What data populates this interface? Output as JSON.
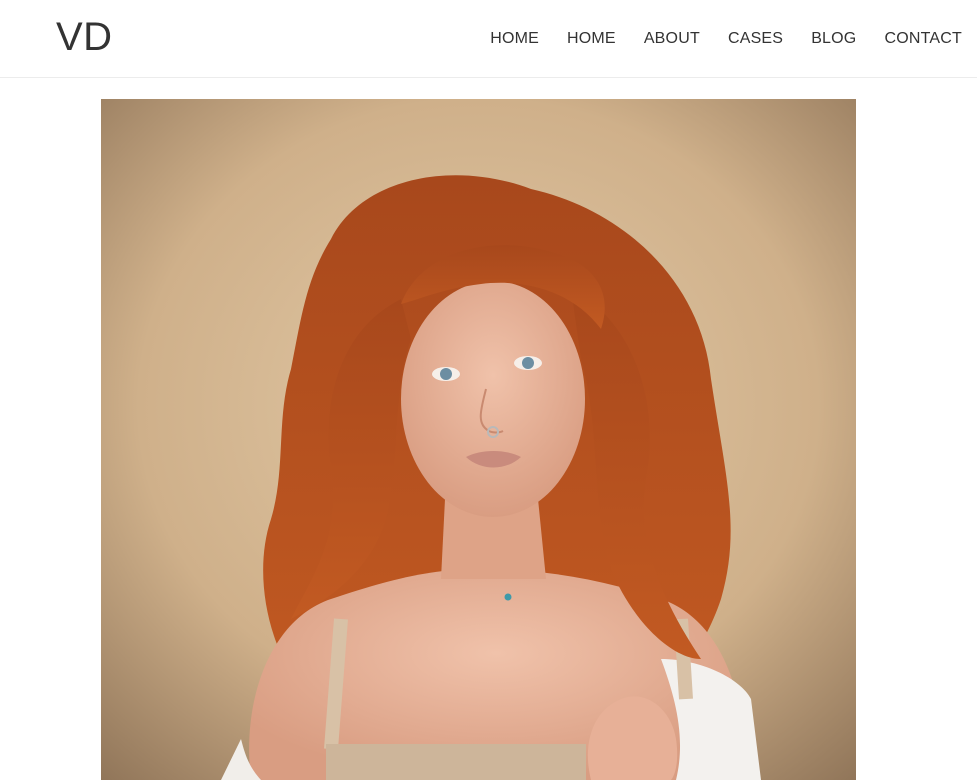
{
  "header": {
    "logo": "VD",
    "nav": [
      {
        "label": "HOME"
      },
      {
        "label": "HOME"
      },
      {
        "label": "ABOUT"
      },
      {
        "label": "CASES"
      },
      {
        "label": "BLOG"
      },
      {
        "label": "CONTACT"
      }
    ]
  },
  "colors": {
    "text": "#333333",
    "background": "#ffffff",
    "divider": "#ececec",
    "photo_backdrop": "#c9ab84",
    "hair": "#b4501f",
    "skin": "#e3a98f"
  }
}
